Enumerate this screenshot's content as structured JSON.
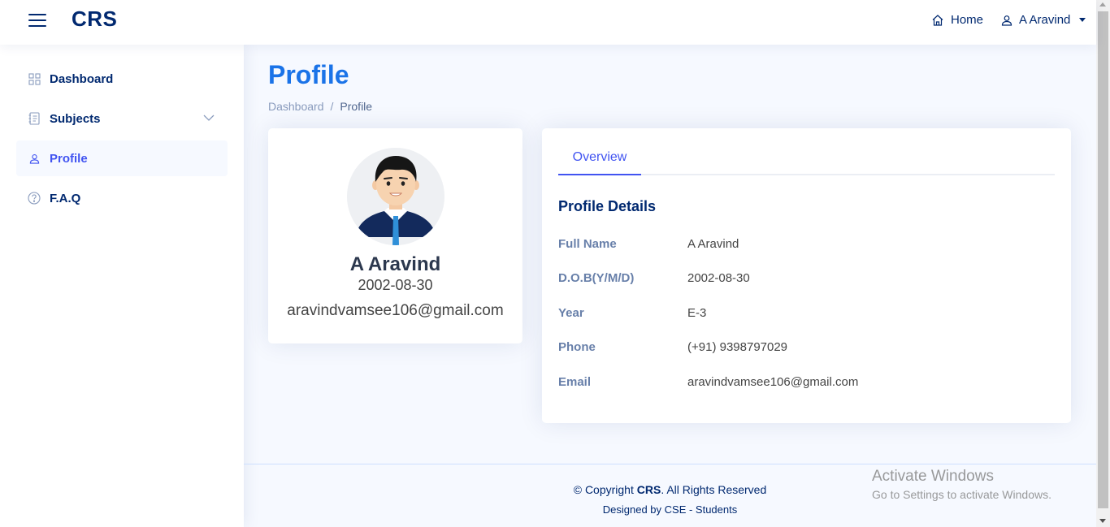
{
  "header": {
    "logo": "CRS",
    "home_label": "Home",
    "user_label": "A Aravind"
  },
  "sidebar": {
    "items": [
      {
        "label": "Dashboard",
        "icon": "grid-icon"
      },
      {
        "label": "Subjects",
        "icon": "journal-icon"
      },
      {
        "label": "Profile",
        "icon": "person-icon",
        "active": true
      },
      {
        "label": "F.A.Q",
        "icon": "question-circle-icon"
      }
    ]
  },
  "page": {
    "title": "Profile",
    "breadcrumb": [
      "Dashboard",
      "/",
      "Profile"
    ]
  },
  "profile_card": {
    "name": "A Aravind",
    "dob": "2002-08-30",
    "email": "aravindvamsee106@gmail.com"
  },
  "details": {
    "tab": "Overview",
    "title": "Profile Details",
    "rows": [
      {
        "label": "Full Name",
        "value": "A Aravind"
      },
      {
        "label": "D.O.B(Y/M/D)",
        "value": "2002-08-30"
      },
      {
        "label": "Year",
        "value": "E-3"
      },
      {
        "label": "Phone",
        "value": "(+91) 9398797029"
      },
      {
        "label": "Email",
        "value": "aravindvamsee106@gmail.com"
      }
    ]
  },
  "footer": {
    "copyright_prefix": "© Copyright",
    "copyright_brand": "CRS",
    "copyright_suffix": ". All Rights Reserved",
    "designed": "Designed by CSE - Students"
  },
  "watermark": {
    "line1": "Activate Windows",
    "line2": "Go to Settings to activate Windows."
  },
  "colors": {
    "primary": "#4154f1",
    "navy": "#012970",
    "title_blue": "#1a73e8",
    "background": "#f6f9ff"
  }
}
